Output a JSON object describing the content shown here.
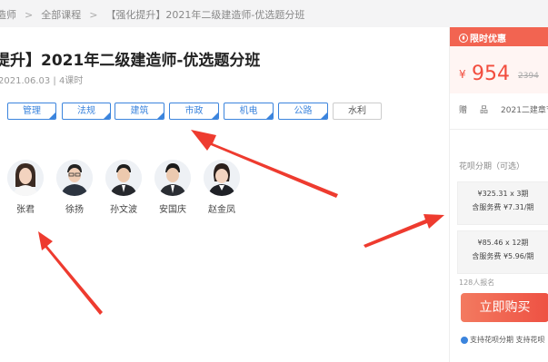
{
  "breadcrumb": {
    "items": [
      "造师",
      "全部课程",
      "【强化提升】2021年二级建造师-优选题分班"
    ],
    "separator": ">"
  },
  "course": {
    "title": "提升】2021年二级建造师-优选题分班",
    "meta": "2021.06.03 | 4课时"
  },
  "tags": [
    {
      "label": "管理",
      "selected": true
    },
    {
      "label": "法规",
      "selected": true
    },
    {
      "label": "建筑",
      "selected": true
    },
    {
      "label": "市政",
      "selected": true
    },
    {
      "label": "机电",
      "selected": true
    },
    {
      "label": "公路",
      "selected": true
    },
    {
      "label": "水利",
      "selected": false
    }
  ],
  "teachers": [
    {
      "name": "张君"
    },
    {
      "name": "徐扬"
    },
    {
      "name": "孙文波"
    },
    {
      "name": "安国庆"
    },
    {
      "name": "赵金凤"
    }
  ],
  "panel": {
    "promo_icon": "flame-icon",
    "promo_label": "限时优惠",
    "currency": "¥",
    "price": "954",
    "original_price": "2394",
    "gift_key": "赠",
    "gift_mid": "品",
    "gift_value": "2021二建章节",
    "installment_title": "花呗分期（可选）",
    "plans": [
      {
        "line1": "¥325.31 x 3期",
        "line2": "含服务费 ¥7.31/期"
      },
      {
        "line1": "¥85.46 x 12期",
        "line2": "含服务费 ¥5.96/期"
      }
    ],
    "signups": "128人报名",
    "buy_label": "立即购买",
    "support": "支持花呗分期 支持花呗"
  },
  "colors": {
    "accent_blue": "#3b84dd",
    "promo_red": "#f26451",
    "price_red": "#f24d3e",
    "annotation_arrow": "#ee3b2f"
  }
}
